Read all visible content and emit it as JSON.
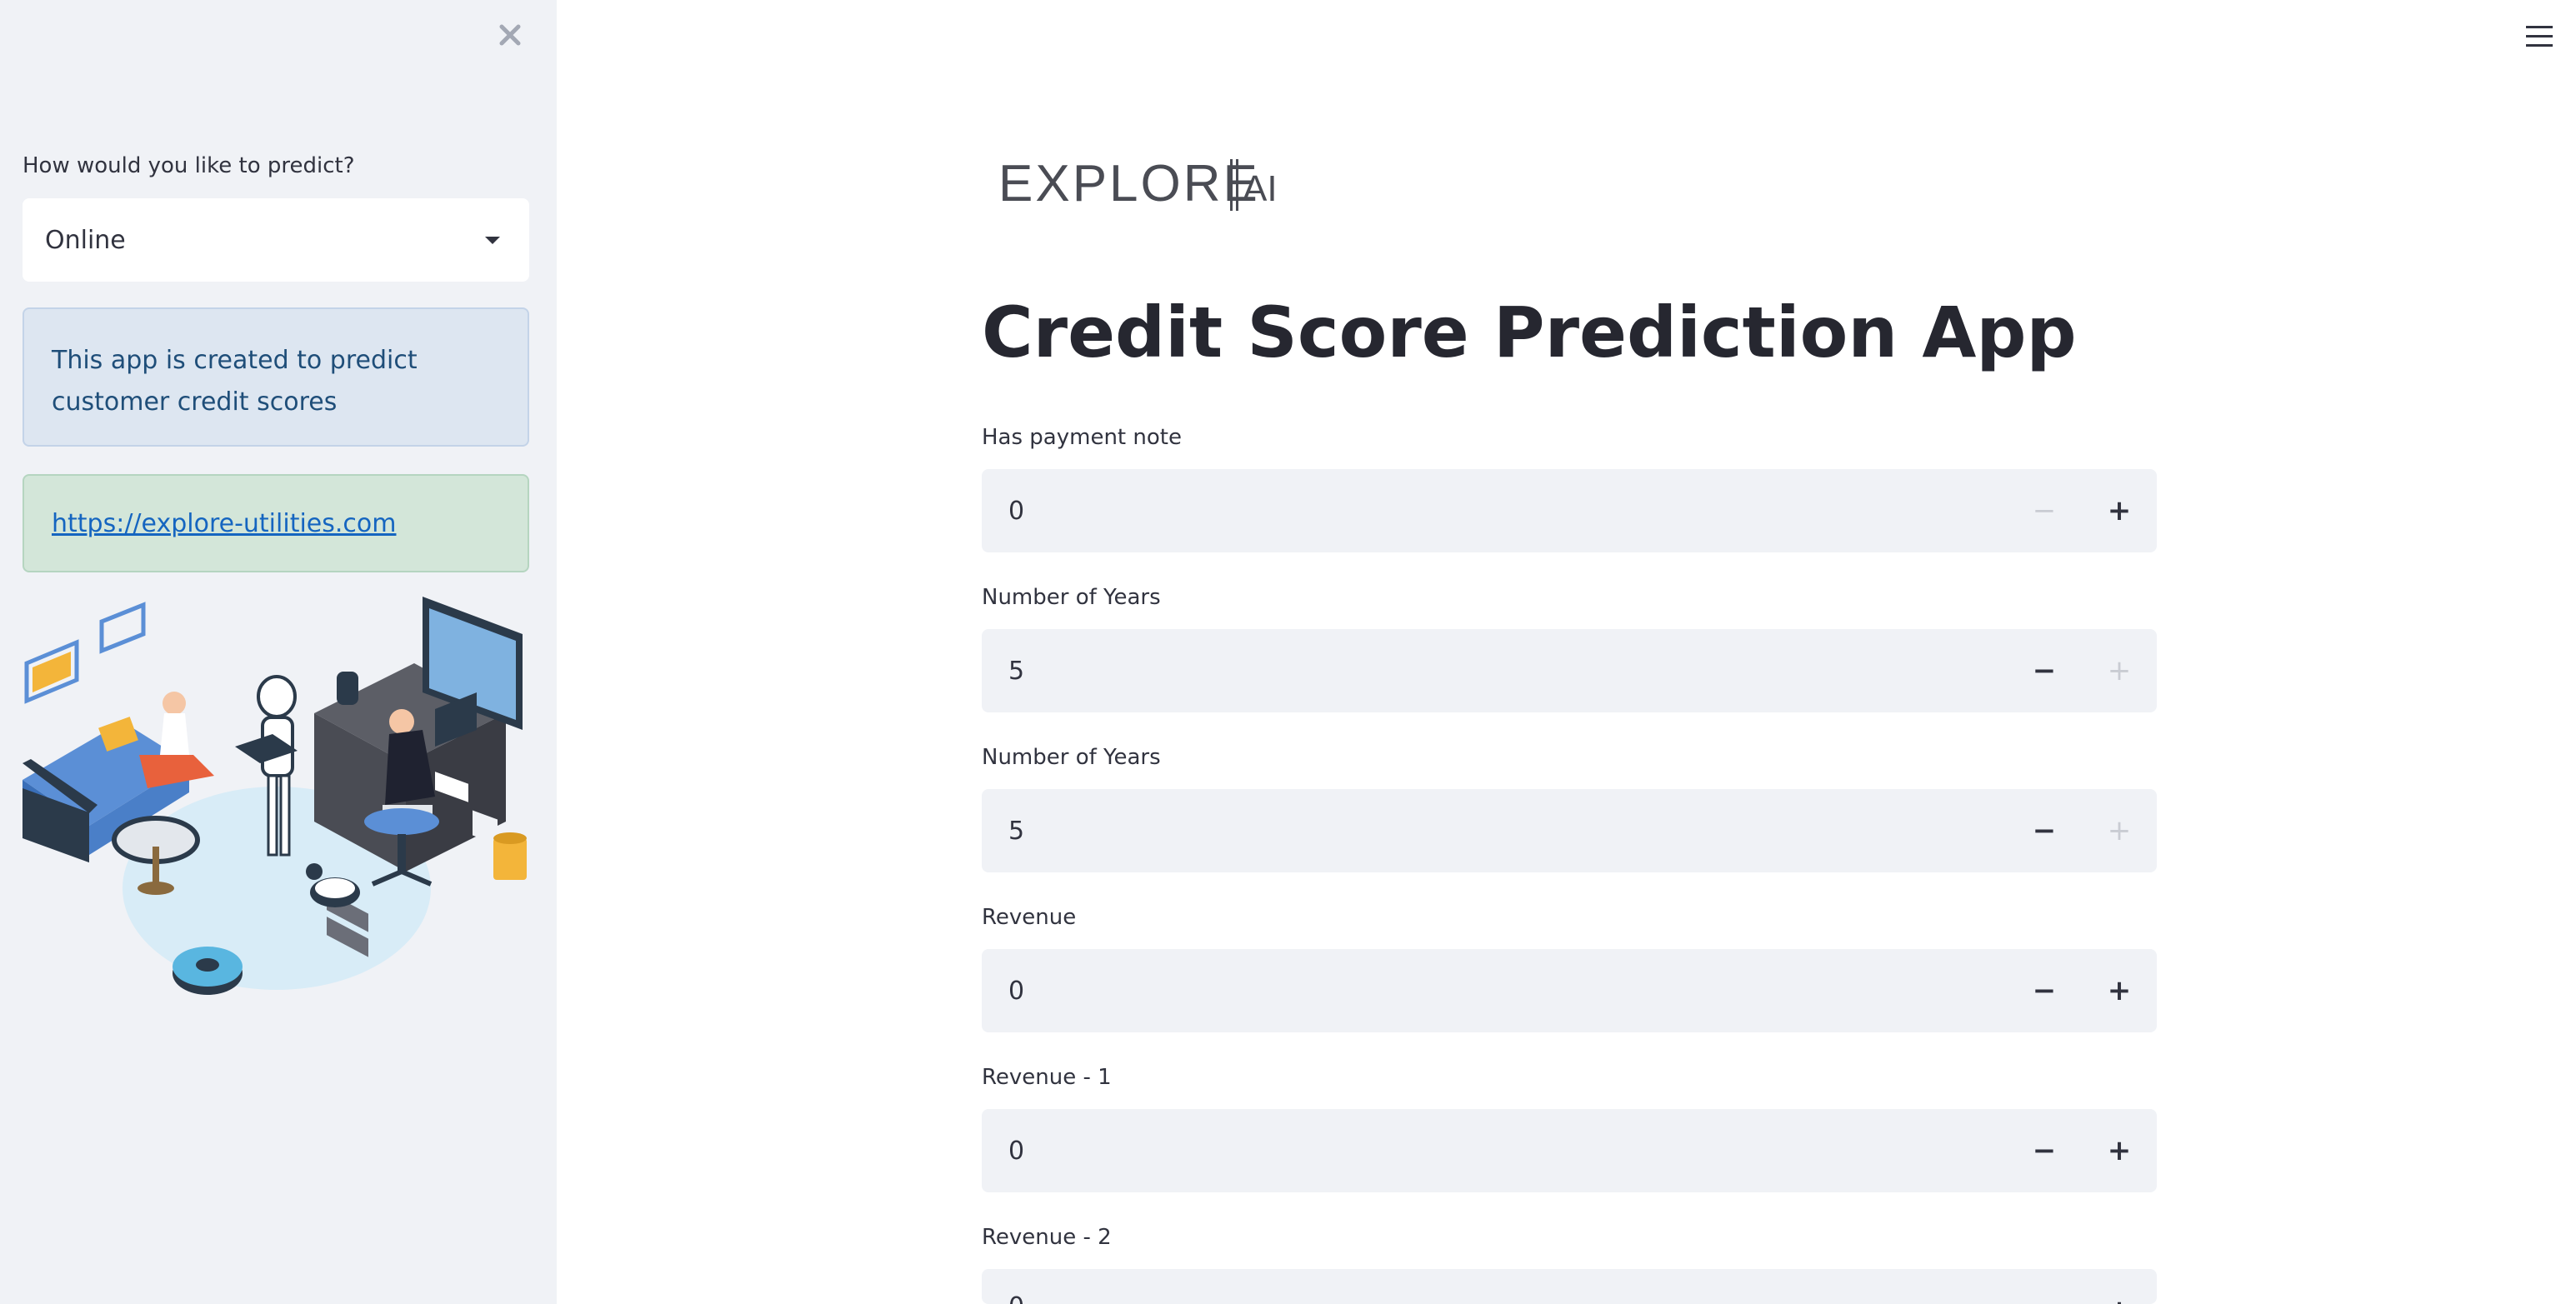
{
  "sidebar": {
    "predict_label": "How would you like to predict?",
    "predict_selected": "Online",
    "info_text": "This app is created to predict customer credit scores",
    "link_text": "https://explore-utilities.com"
  },
  "main": {
    "logo_text": "EXPLORE",
    "logo_suffix": "AI",
    "title": "Credit Score Prediction App",
    "fields": [
      {
        "label": "Has payment note",
        "value": "0"
      },
      {
        "label": "Number of Years",
        "value": "5"
      },
      {
        "label": "Number of Years",
        "value": "5"
      },
      {
        "label": "Revenue",
        "value": "0"
      },
      {
        "label": "Revenue - 1",
        "value": "0"
      },
      {
        "label": "Revenue - 2",
        "value": "0"
      }
    ]
  },
  "icons": {
    "close": "close-icon",
    "menu": "hamburger-menu-icon",
    "dropdown": "chevron-down-icon",
    "minus": "minus-icon",
    "plus": "plus-icon"
  },
  "colors": {
    "sidebar_bg": "#f0f2f6",
    "info_bg": "#dde6f1",
    "success_bg": "#d3e6d9",
    "link": "#1565c0",
    "input_bg": "#f0f2f6"
  }
}
